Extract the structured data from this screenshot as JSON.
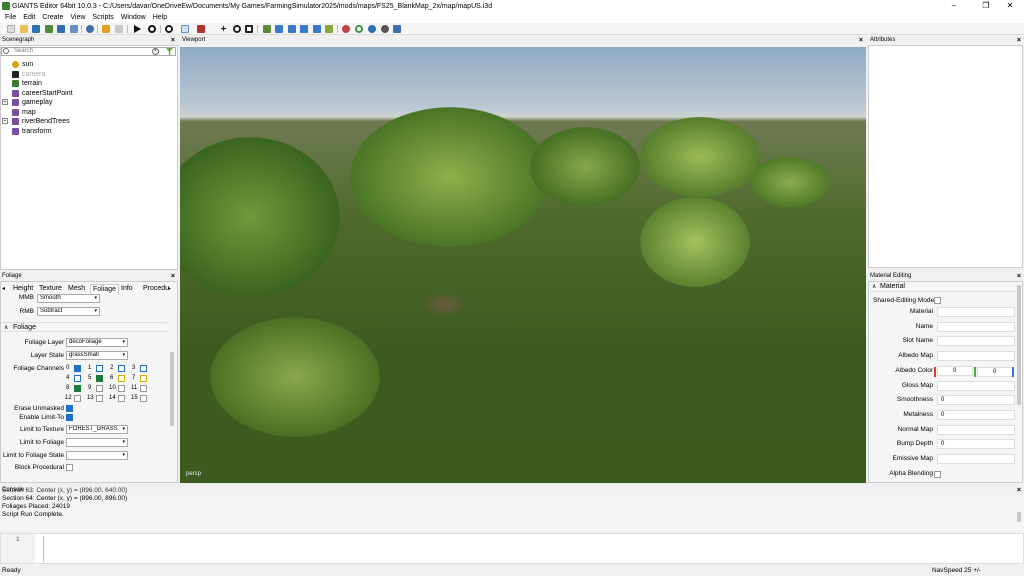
{
  "window": {
    "title": "GIANTS Editor 64bit 10.0.3 - C:/Users/davar/OneDriveEw/Documents/My Games/FarmingSimulator2025/mods/maps/FS25_BlankMap_2x/map/mapUS.i3d",
    "minimize": "–",
    "maximize": "❐",
    "close": "✕"
  },
  "menu": [
    "File",
    "Edit",
    "Create",
    "View",
    "Scripts",
    "Window",
    "Help"
  ],
  "toolbar": {
    "icons": [
      "new-icon",
      "open-icon",
      "save-icon",
      "save-as-icon",
      "refresh-icon",
      "import-icon",
      "undo-icon",
      "redo-icon",
      "play-icon",
      "eye-icon",
      "zoom-icon",
      "select-icon",
      "brush-icon",
      "move-icon",
      "rotate-icon",
      "scale-icon",
      "terrain-icon",
      "paint-icon",
      "foliage-icon",
      "place-icon",
      "decal-icon",
      "sphere-icon",
      "cycle-icon",
      "grid-icon",
      "settings-icon",
      "layers-icon"
    ]
  },
  "scenegraph": {
    "title": "Scenegraph",
    "search_placeholder": "Search",
    "items": [
      {
        "label": "sun",
        "icon": "light-icon",
        "color": "#d4a017",
        "grey": false,
        "expand": ""
      },
      {
        "label": "camera",
        "icon": "camera-icon",
        "color": "#222",
        "grey": true,
        "expand": ""
      },
      {
        "label": "terrain",
        "icon": "terrain-icon",
        "color": "#3b7d2f",
        "grey": false,
        "expand": ""
      },
      {
        "label": "careerStartPoint",
        "icon": "transform-icon",
        "color": "#7a4fa0",
        "grey": false,
        "expand": ""
      },
      {
        "label": "gameplay",
        "icon": "transform-icon",
        "color": "#7a4fa0",
        "grey": false,
        "expand": "+"
      },
      {
        "label": "map",
        "icon": "transform-icon",
        "color": "#7a4fa0",
        "grey": false,
        "expand": ""
      },
      {
        "label": "riverBendTrees",
        "icon": "transform-icon",
        "color": "#7a4fa0",
        "grey": false,
        "expand": "+"
      },
      {
        "label": "transform",
        "icon": "transform-icon",
        "color": "#7a4fa0",
        "grey": false,
        "expand": ""
      }
    ]
  },
  "viewport": {
    "title": "Viewport",
    "persp_label": "persp"
  },
  "attributes": {
    "title": "Attributes"
  },
  "foliage_panel": {
    "title": "Foliage",
    "tabs": [
      "Height",
      "Texture",
      "Mesh",
      "Foliage",
      "Info",
      "Procedural"
    ],
    "mmb_label": "MMB",
    "mmb_value": "Smooth",
    "rmb_label": "RMB",
    "rmb_value": "Subtract",
    "section": "Foliage",
    "layer_label": "Foliage Layer",
    "layer_value": "decoFoliage",
    "state_label": "Layer State",
    "state_value": "grassSmall",
    "channels_label": "Foliage Channels",
    "channels": [
      {
        "n": "0",
        "on": true,
        "color": "#1e6fc8"
      },
      {
        "n": "1",
        "on": false,
        "color": "#1e6fc8"
      },
      {
        "n": "2",
        "on": false,
        "color": "#1e6fc8"
      },
      {
        "n": "3",
        "on": false,
        "color": "#1e6fc8"
      },
      {
        "n": "4",
        "on": false,
        "color": "#1e6fc8"
      },
      {
        "n": "5",
        "on": true,
        "color": "#1a7a3a"
      },
      {
        "n": "6",
        "on": false,
        "color": "#d0b000"
      },
      {
        "n": "7",
        "on": false,
        "color": "#d0b000"
      },
      {
        "n": "8",
        "on": true,
        "color": "#1a7a3a"
      },
      {
        "n": "9",
        "on": false,
        "color": "#999"
      },
      {
        "n": "10",
        "on": false,
        "color": "#999"
      },
      {
        "n": "11",
        "on": false,
        "color": "#999"
      },
      {
        "n": "12",
        "on": false,
        "color": "#999"
      },
      {
        "n": "13",
        "on": false,
        "color": "#999"
      },
      {
        "n": "14",
        "on": false,
        "color": "#999"
      },
      {
        "n": "15",
        "on": false,
        "color": "#999"
      }
    ],
    "erase_label": "Erase Unmasked",
    "erase_on": true,
    "limit_to_label": "Enable Limit-To",
    "limit_to_on": true,
    "limit_texture_label": "Limit to Texture",
    "limit_texture_value": "FOREST_GRASS",
    "limit_foliage_label": "Limit to Foliage",
    "limit_foliage_value": "",
    "limit_state_label": "Limit to Foliage State",
    "limit_state_value": "",
    "block_label": "Block Procedural",
    "block_on": false
  },
  "material_panel": {
    "title": "Material Editing",
    "section": "Material",
    "shared_label": "Shared-Editing Mode",
    "rows": [
      {
        "label": "Material",
        "value": ""
      },
      {
        "label": "Name",
        "value": ""
      },
      {
        "label": "Slot Name",
        "value": ""
      },
      {
        "label": "Albedo Map",
        "value": ""
      },
      {
        "label": "Albedo Color",
        "value": "0"
      },
      {
        "label": "Gloss Map",
        "value": ""
      },
      {
        "label": "Smoothness",
        "value": "0"
      },
      {
        "label": "Metalness",
        "value": "0"
      },
      {
        "label": "Normal Map",
        "value": ""
      },
      {
        "label": "Bump Depth",
        "value": "0"
      },
      {
        "label": "Emissive Map",
        "value": ""
      },
      {
        "label": "Alpha Blending",
        "value": ""
      }
    ],
    "albedo_second": "0"
  },
  "console": {
    "title": "Console",
    "lines": [
      "Section 63: Center (x, y) = (896.00, 640.00)",
      "Section 64: Center (x, y) = (896.00, 896.00)",
      "Foliages Placed: 24019",
      "Script Run Complete."
    ],
    "line_number": "1"
  },
  "status": {
    "left": "Ready",
    "right": "NavSpeed 25 +/-"
  }
}
